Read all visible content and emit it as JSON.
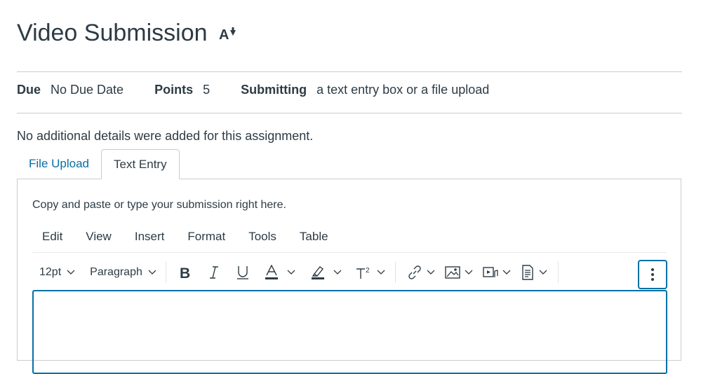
{
  "page": {
    "title": "Video Submission"
  },
  "meta": {
    "due_label": "Due",
    "due_value": "No Due Date",
    "points_label": "Points",
    "points_value": "5",
    "submitting_label": "Submitting",
    "submitting_value": "a text entry box or a file upload"
  },
  "details": "No additional details were added for this assignment.",
  "tabs": [
    {
      "label": "File Upload"
    },
    {
      "label": "Text Entry"
    }
  ],
  "editor": {
    "instructions": "Copy and paste or type your submission right here.",
    "menubar": [
      "Edit",
      "View",
      "Insert",
      "Format",
      "Tools",
      "Table"
    ],
    "font_size": "12pt",
    "block_format": "Paragraph"
  },
  "colors": {
    "text": "#2d3b45",
    "link": "#0770a3",
    "border": "#c7cdd1"
  }
}
